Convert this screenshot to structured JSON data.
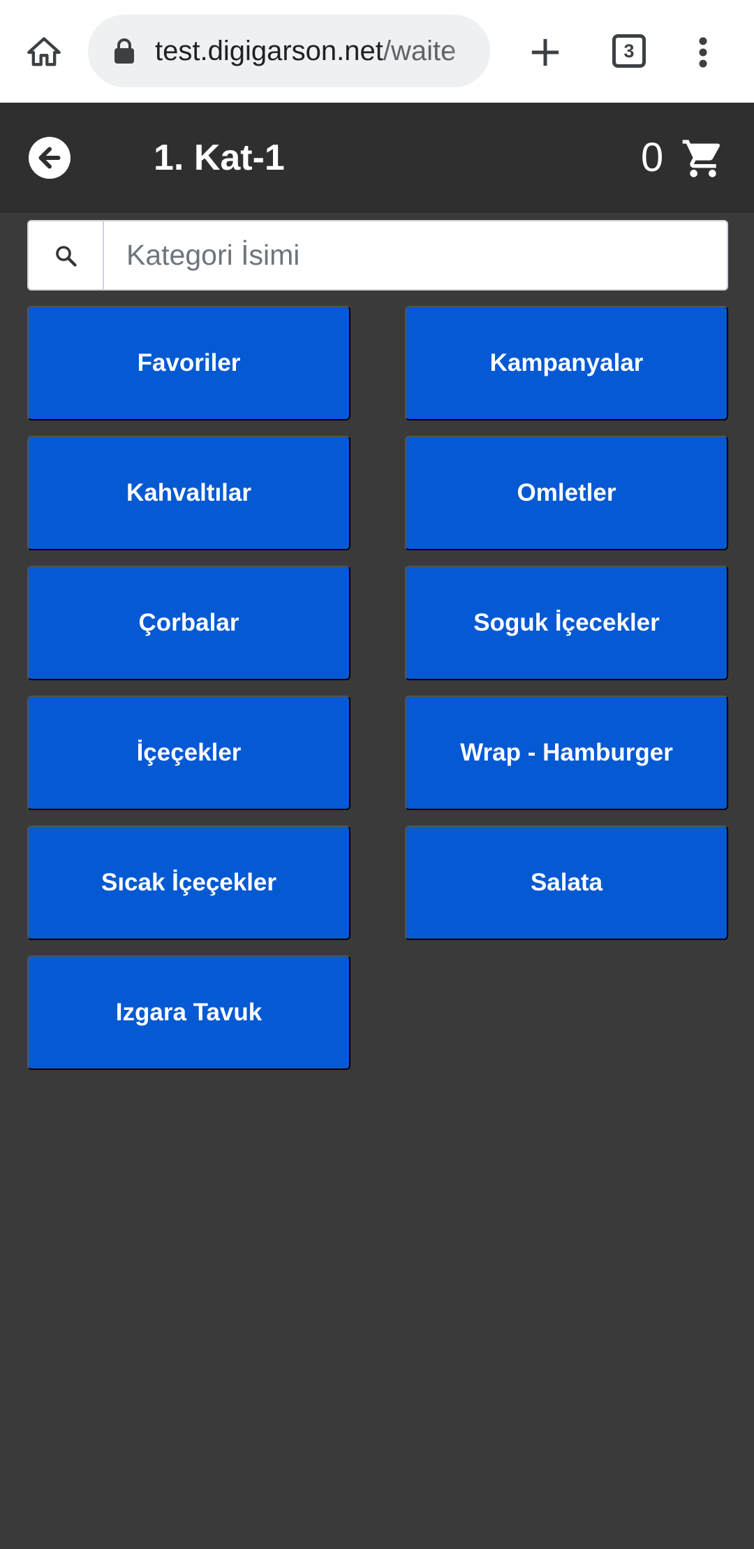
{
  "browser": {
    "url_main": "test.digigarson.net",
    "url_path": "/waite",
    "tab_count": "3",
    "icons": [
      "home-icon",
      "lock-icon",
      "plus-icon",
      "tabs-icon",
      "more-vert-icon"
    ]
  },
  "header": {
    "title": "1. Kat-1",
    "cart_count": "0",
    "icons": [
      "back-arrow-icon",
      "cart-icon"
    ]
  },
  "search": {
    "placeholder": "Kategori İsimi",
    "value": ""
  },
  "categories": [
    {
      "label": "Favoriler"
    },
    {
      "label": "Kampanyalar"
    },
    {
      "label": "Kahvaltılar"
    },
    {
      "label": "Omletler"
    },
    {
      "label": "Çorbalar"
    },
    {
      "label": "Soguk İçecekler"
    },
    {
      "label": "İçeçekler"
    },
    {
      "label": "Wrap - Hamburger"
    },
    {
      "label": "Sıcak İçeçekler"
    },
    {
      "label": "Salata"
    },
    {
      "label": "Izgara Tavuk"
    }
  ],
  "colors": {
    "category_button": "#0559d3",
    "header_bg": "#2f2f2f",
    "page_bg": "#3a3a3a"
  }
}
